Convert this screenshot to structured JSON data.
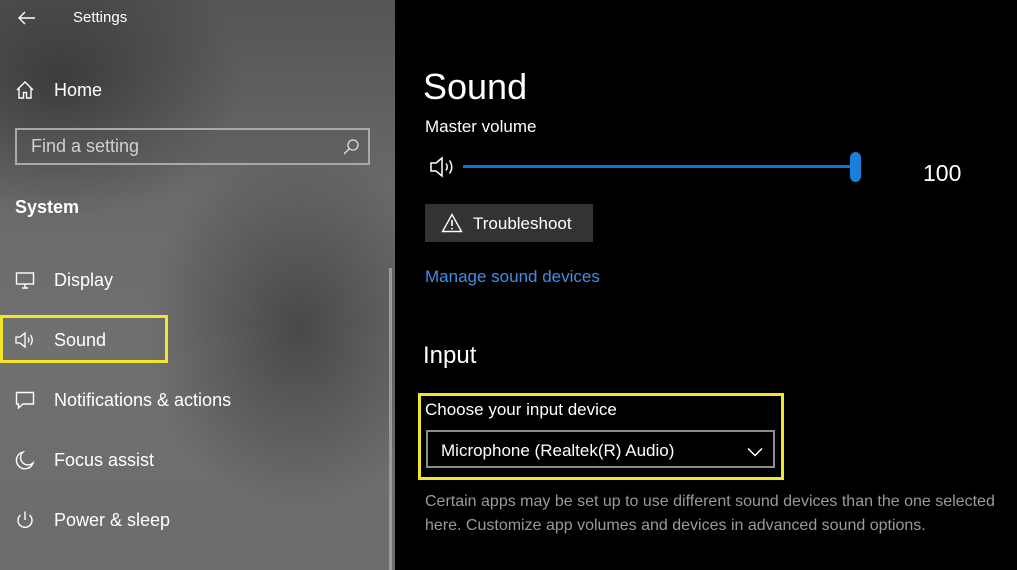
{
  "window": {
    "title": "Settings"
  },
  "sidebar": {
    "home_label": "Home",
    "search_placeholder": "Find a setting",
    "section_label": "System",
    "items": [
      {
        "label": "Display",
        "icon": "display-icon"
      },
      {
        "label": "Sound",
        "icon": "speaker-icon",
        "selected": true
      },
      {
        "label": "Notifications & actions",
        "icon": "notifications-icon"
      },
      {
        "label": "Focus assist",
        "icon": "moon-icon"
      },
      {
        "label": "Power & sleep",
        "icon": "power-icon"
      }
    ]
  },
  "main": {
    "title": "Sound",
    "master_volume_label": "Master volume",
    "master_volume_value": "100",
    "troubleshoot_label": "Troubleshoot",
    "manage_link": "Manage sound devices",
    "input_heading": "Input",
    "input_device_label": "Choose your input device",
    "input_device_value": "Microphone (Realtek(R) Audio)",
    "input_description": "Certain apps may be set up to use different sound devices than the one selected here. Customize app volumes and devices in advanced sound options."
  },
  "colors": {
    "accent": "#0f74d1",
    "link": "#3f8ee8",
    "highlight": "#f2e52a"
  }
}
